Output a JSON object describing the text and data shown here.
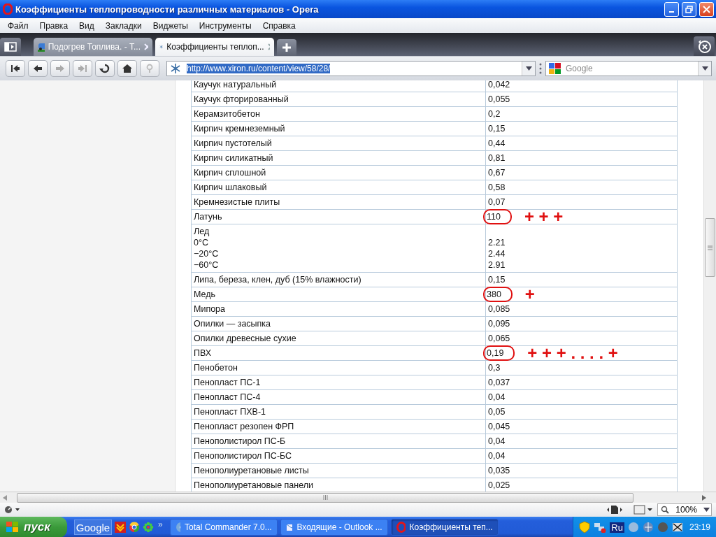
{
  "window": {
    "title": "Коэффициенты теплопроводности различных материалов - Opera"
  },
  "menu": [
    "Файл",
    "Правка",
    "Вид",
    "Закладки",
    "Виджеты",
    "Инструменты",
    "Справка"
  ],
  "tabs": [
    {
      "label": "Подогрев Топлива. - Т...",
      "selected": false
    },
    {
      "label": "Коэффициенты теплоп...",
      "selected": true
    }
  ],
  "address": {
    "url": "http://www.xiron.ru/content/view/58/28/",
    "selected": true
  },
  "search": {
    "placeholder": "Google"
  },
  "table": {
    "rows": [
      {
        "kind": "single",
        "name": "Каучук натуральный",
        "value": "0,042",
        "circled": false
      },
      {
        "kind": "single",
        "name": "Каучук фторированный",
        "value": "0,055",
        "circled": false
      },
      {
        "kind": "single",
        "name": "Керамзитобетон",
        "value": "0,2",
        "circled": false
      },
      {
        "kind": "single",
        "name": "Кирпич кремнеземный",
        "value": "0,15",
        "circled": false
      },
      {
        "kind": "single",
        "name": "Кирпич пустотелый",
        "value": "0,44",
        "circled": false
      },
      {
        "kind": "single",
        "name": "Кирпич силикатный",
        "value": "0,81",
        "circled": false
      },
      {
        "kind": "single",
        "name": "Кирпич сплошной",
        "value": "0,67",
        "circled": false
      },
      {
        "kind": "single",
        "name": "Кирпич шлаковый",
        "value": "0,58",
        "circled": false
      },
      {
        "kind": "single",
        "name": "Кремнезистые плиты",
        "value": "0,07",
        "circled": false
      },
      {
        "kind": "single",
        "name": "Латунь",
        "value": "110",
        "circled": true,
        "annotation": "+ + +"
      },
      {
        "kind": "multi",
        "name": "Лед",
        "lines": [
          {
            "label": "0°C",
            "value": "2.21"
          },
          {
            "label": "−20°C",
            "value": "2.44"
          },
          {
            "label": "−60°C",
            "value": "2.91"
          }
        ],
        "circled": false
      },
      {
        "kind": "single",
        "name": "Липа, береза, клен, дуб (15% влажности)",
        "value": "0,15",
        "circled": false
      },
      {
        "kind": "single",
        "name": "Медь",
        "value": "380",
        "circled": true,
        "annotation": "+"
      },
      {
        "kind": "single",
        "name": "Мипора",
        "value": "0,085",
        "circled": false
      },
      {
        "kind": "single",
        "name": "Опилки — засыпка",
        "value": "0,095",
        "circled": false
      },
      {
        "kind": "single",
        "name": "Опилки древесные сухие",
        "value": "0,065",
        "circled": false
      },
      {
        "kind": "single",
        "name": "ПВХ",
        "value": "0,19",
        "circled": true,
        "annotation": "+ + + . . . . +"
      },
      {
        "kind": "single",
        "name": "Пенобетон",
        "value": "0,3",
        "circled": false
      },
      {
        "kind": "single",
        "name": "Пенопласт ПС-1",
        "value": "0,037",
        "circled": false
      },
      {
        "kind": "single",
        "name": "Пенопласт ПС-4",
        "value": "0,04",
        "circled": false
      },
      {
        "kind": "single",
        "name": "Пенопласт ПХВ-1",
        "value": "0,05",
        "circled": false
      },
      {
        "kind": "single",
        "name": "Пенопласт резопен ФРП",
        "value": "0,045",
        "circled": false
      },
      {
        "kind": "single",
        "name": "Пенополистирол ПС-Б",
        "value": "0,04",
        "circled": false
      },
      {
        "kind": "single",
        "name": "Пенополистирол ПС-БС",
        "value": "0,04",
        "circled": false
      },
      {
        "kind": "single",
        "name": "Пенополиуретановые листы",
        "value": "0,035",
        "circled": false
      },
      {
        "kind": "single",
        "name": "Пенополиуретановые панели",
        "value": "0,025",
        "circled": false
      }
    ]
  },
  "status": {
    "zoom": "100%"
  },
  "taskbar": {
    "start": "пуск",
    "toolbar": "Google",
    "chevron": "»",
    "tasks": [
      {
        "label": "Total Commander 7.0...",
        "selected": false
      },
      {
        "label": "Входящие - Outlook ...",
        "selected": false
      },
      {
        "label": "Коэффициенты теп...",
        "selected": true
      }
    ],
    "lang": "Ru",
    "clock": "23:19"
  }
}
